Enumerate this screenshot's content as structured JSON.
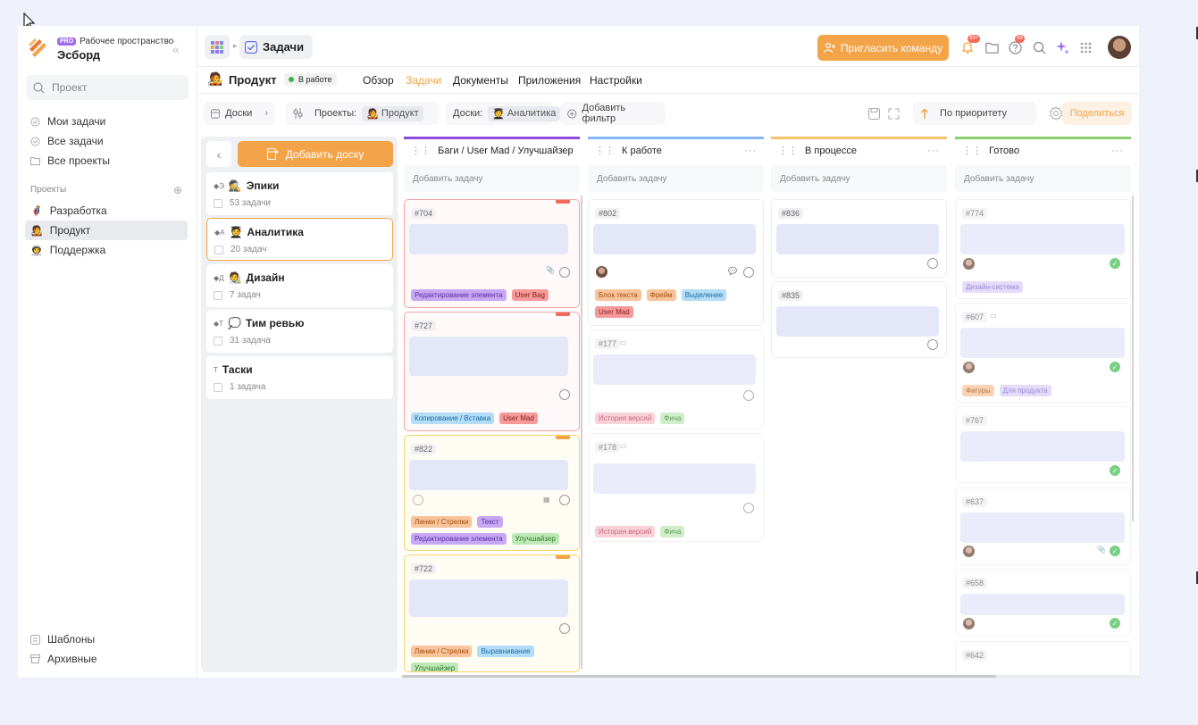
{
  "workspace": {
    "pro_badge": "PRO",
    "label": "Рабочее пространство",
    "name": "Эсборд"
  },
  "search": {
    "placeholder": "Проект"
  },
  "nav": [
    {
      "label": "Мои задачи",
      "icon": "clock-check-icon"
    },
    {
      "label": "Все задачи",
      "icon": "clock-check-icon"
    },
    {
      "label": "Все проекты",
      "icon": "folder-icon"
    }
  ],
  "projects_section": {
    "label": "Проекты"
  },
  "projects": [
    {
      "label": "Разработка",
      "emoji": "🦸"
    },
    {
      "label": "Продукт",
      "emoji": "🧑‍🎤"
    },
    {
      "label": "Поддержка",
      "emoji": "🧑‍🚀"
    }
  ],
  "bottom_nav": [
    {
      "label": "Шаблоны",
      "icon": "template-icon"
    },
    {
      "label": "Архивные",
      "icon": "archive-icon"
    }
  ],
  "topbar": {
    "breadcrumb": "Задачи",
    "invite_label": "Пригласить команду",
    "notif_badge": "99+",
    "help_badge": "99"
  },
  "project": {
    "emoji": "🧑‍🎤",
    "name": "Продукт",
    "status": "В работе",
    "tabs": [
      "Обзор",
      "Задачи",
      "Документы",
      "Приложения",
      "Настройки"
    ],
    "active_tab": "Задачи"
  },
  "filters": {
    "boards_label": "Доски",
    "projects_label": "Проекты:",
    "projects_value": "Продукт",
    "boards_filter_label": "Доски:",
    "boards_filter_value": "Аналитика",
    "add_filter": "Добавить фильтр",
    "sort": "По приоритету",
    "share": "Поделиться"
  },
  "boards_panel": {
    "add_board": "Добавить доску",
    "boards": [
      {
        "prefix": "◆Э",
        "emoji": "🕵️",
        "title": "Эпики",
        "count": "53 задачи"
      },
      {
        "prefix": "◆А",
        "emoji": "🧑‍🎓",
        "title": "Аналитика",
        "count": "20 задач"
      },
      {
        "prefix": "◆Д",
        "emoji": "🧑‍🎨",
        "title": "Дизайн",
        "count": "7 задач"
      },
      {
        "prefix": "◆Т",
        "emoji": "💭",
        "title": "Тим ревью",
        "count": "31 задача"
      },
      {
        "prefix": "Т",
        "emoji": "",
        "title": "Таски",
        "count": "1 задача"
      }
    ]
  },
  "columns": [
    {
      "title": "Баги / User Mad / Улучшайзер",
      "color": "#8e4be0"
    },
    {
      "title": "К работе",
      "color": "#86b9f3"
    },
    {
      "title": "В процессе",
      "color": "#f5c36a"
    },
    {
      "title": "Готово",
      "color": "#8ccf6f"
    }
  ],
  "add_task_label": "Добавить задачу",
  "cards": {
    "c704": {
      "id": "#704",
      "tags": [
        "Редактирование элемента",
        "User Bag"
      ]
    },
    "c727": {
      "id": "#727",
      "tags": [
        "Копирование / Вставка",
        "User Mad"
      ]
    },
    "c822": {
      "id": "#822",
      "tags": [
        "Линии / Стрелки",
        "Текст",
        "Редактирование элемента",
        "Улучшайзер"
      ]
    },
    "c722": {
      "id": "#722",
      "tags": [
        "Линии / Стрелки",
        "Выравнивание",
        "Улучшайзер"
      ]
    },
    "c802": {
      "id": "#802",
      "tags": [
        "Блок текста",
        "Фрейм",
        "Выделение",
        "User Mad"
      ]
    },
    "c177": {
      "id": "#177",
      "tags": [
        "История версий",
        "Фича"
      ]
    },
    "c178": {
      "id": "#178",
      "tags": [
        "История версий",
        "Фича"
      ]
    },
    "c836a": {
      "id": "#836"
    },
    "c836b": {
      "id": "#835"
    },
    "c774": {
      "id": "#774",
      "tags": [
        "Дизайн-система"
      ]
    },
    "c607": {
      "id": "#607",
      "tags": [
        "Фигуры",
        "Для продукта"
      ]
    },
    "c767": {
      "id": "#767"
    },
    "c637": {
      "id": "#637"
    },
    "c658": {
      "id": "#658"
    },
    "c642": {
      "id": "#642"
    }
  }
}
